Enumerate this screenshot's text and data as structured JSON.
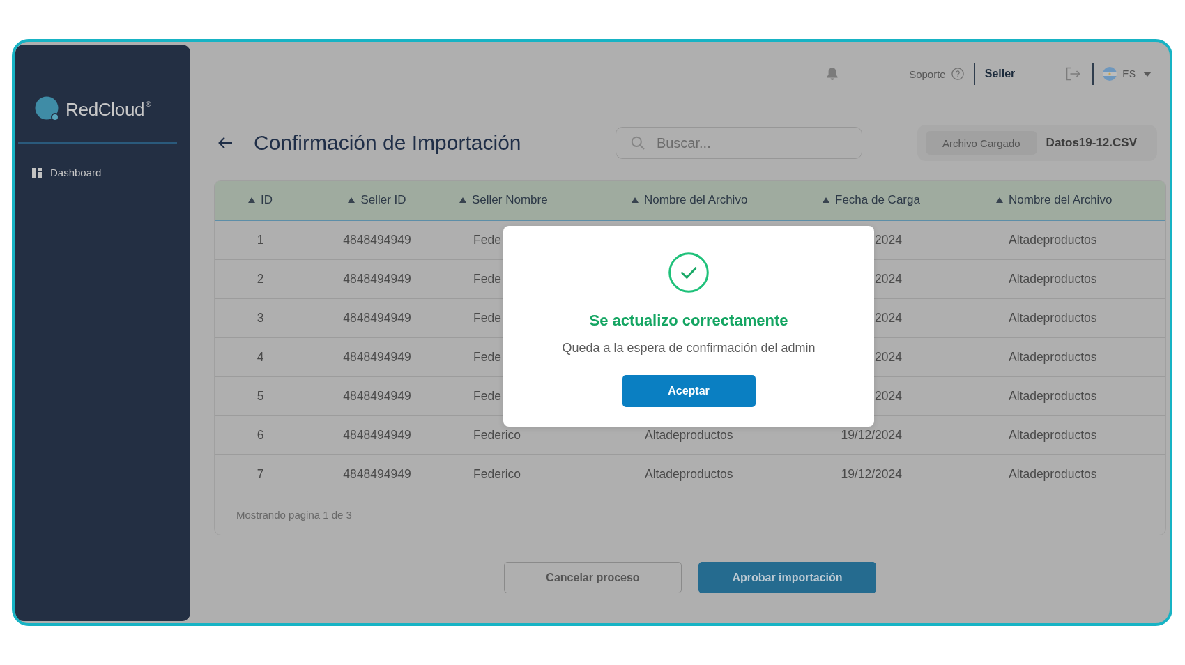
{
  "sidebar": {
    "logo": "RedCloud$^{®}$",
    "items": [
      {
        "label": "Dashboard"
      }
    ]
  },
  "header": {
    "support": "Soporte",
    "user": "Seller",
    "language": "ES"
  },
  "page": {
    "title": "Confirmación de Importación",
    "search": {
      "placeholder": "Buscar..."
    },
    "file": {
      "label": "Archivo Cargado",
      "name": "Datos19-12.CSV"
    }
  },
  "table": {
    "columns": [
      {
        "label": "ID"
      },
      {
        "label": "Seller ID"
      },
      {
        "label": "Seller Nombre"
      },
      {
        "label": "Nombre del Archivo"
      },
      {
        "label": "Fecha de Carga"
      },
      {
        "label": "Nombre del Archivo"
      }
    ],
    "rows": [
      {
        "id": "1",
        "seller_id": "4848494949",
        "seller_nombre": "Fede",
        "fecha_de_carga": "2024",
        "nombre_del_archivo_2": "Altadeproductos"
      },
      {
        "id": "2",
        "seller_id": "4848494949",
        "seller_nombre": "Fede",
        "fecha_de_carga": "2024",
        "nombre_del_archivo_2": "Altadeproductos"
      },
      {
        "id": "3",
        "seller_id": "4848494949",
        "seller_nombre": "Fede",
        "fecha_de_carga": "2024",
        "nombre_del_archivo_2": "Altadeproductos"
      },
      {
        "id": "4",
        "seller_id": "4848494949",
        "seller_nombre": "Fede",
        "fecha_de_carga": "2024",
        "nombre_del_archivo_2": "Altadeproductos"
      },
      {
        "id": "5",
        "seller_id": "4848494949",
        "seller_nombre": "Fede",
        "fecha_de_carga": "2024",
        "nombre_del_archivo_2": "Altadeproductos"
      },
      {
        "id": "6",
        "seller_id": "4848494949",
        "seller_nombre": "Federico",
        "nombre_del_archivo": "Altadeproductos",
        "fecha_de_carga": "19/12/2024",
        "nombre_del_archivo_2": "Altadeproductos"
      },
      {
        "id": "7",
        "seller_id": "4848494949",
        "seller_nombre": "Federico",
        "nombre_del_archivo": "Altadeproductos",
        "fecha_de_carga": "19/12/2024",
        "nombre_del_archivo_2": "Altadeproductos"
      }
    ],
    "footer": "Mostrando pagina 1 de 3"
  },
  "actions": [
    {
      "label": "Cancelar proceso",
      "kind": "secondary"
    },
    {
      "label": "Aprobar importación",
      "kind": "primary"
    }
  ],
  "dialog": {
    "title": "Se actualizo correctamente",
    "message": "Queda a la espera de confirmación del admin",
    "button": "Aceptar"
  }
}
